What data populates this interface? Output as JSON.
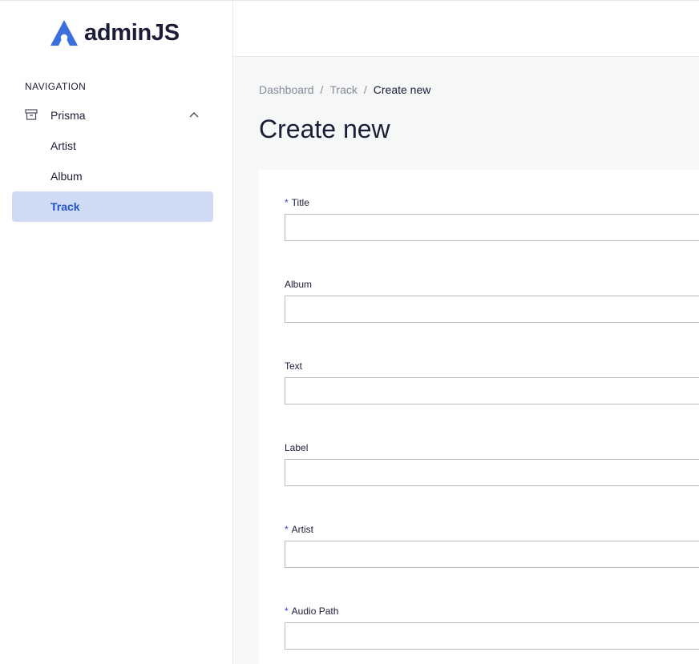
{
  "brand": {
    "name": "adminJS",
    "accent": "#3B6FE0"
  },
  "sidebar": {
    "heading": "NAVIGATION",
    "group": {
      "label": "Prisma",
      "icon": "archive-icon",
      "toggle_icon": "chevron-up-icon"
    },
    "items": [
      {
        "label": "Artist"
      },
      {
        "label": "Album"
      },
      {
        "label": "Track",
        "active": true
      }
    ],
    "active_bg": "#CFDAF4",
    "active_color": "#2054C8"
  },
  "breadcrumb": {
    "items": [
      "Dashboard",
      "Track"
    ],
    "separator": "/",
    "current": "Create new"
  },
  "page": {
    "title": "Create new"
  },
  "form": {
    "required_marker": "*",
    "fields": [
      {
        "label": "Title",
        "required": true,
        "value": ""
      },
      {
        "label": "Album",
        "required": false,
        "value": ""
      },
      {
        "label": "Text",
        "required": false,
        "value": ""
      },
      {
        "label": "Label",
        "required": false,
        "value": ""
      },
      {
        "label": "Artist",
        "required": true,
        "value": ""
      },
      {
        "label": "Audio Path",
        "required": true,
        "value": ""
      }
    ]
  }
}
